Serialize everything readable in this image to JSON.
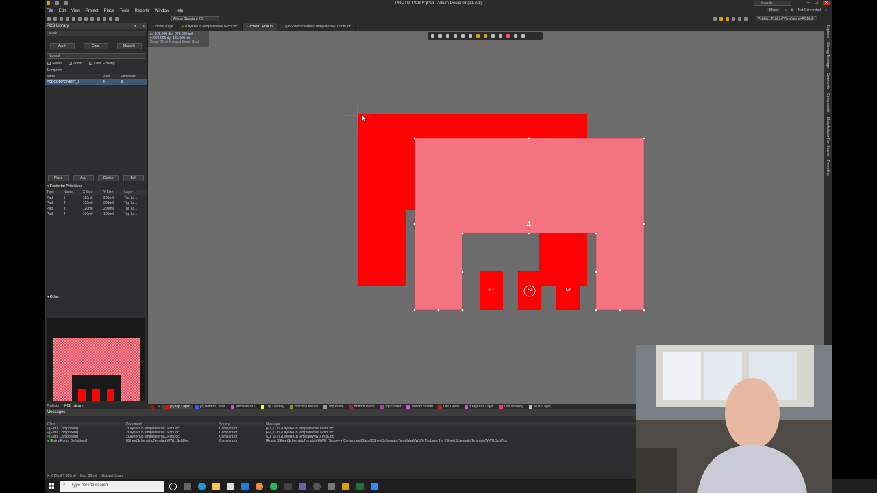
{
  "window": {
    "title": "PROTO_PCB.PrjPcb - Altium Designer (21.8.1)",
    "search_placeholder": "Search",
    "minimize": "–",
    "maximize": "☐",
    "close": "✕"
  },
  "menu": {
    "items": [
      "File",
      "Edit",
      "View",
      "Project",
      "Place",
      "Tools",
      "Reports",
      "Window",
      "Help"
    ],
    "share": "Share",
    "not_connected": "Not Connected"
  },
  "toolbar": {
    "view_combo": "Altium Standard 2D",
    "path": "PcbLib1.PcbLib?ViewName=PCBLib"
  },
  "doc_tabs": [
    {
      "label": "Home Page",
      "active": false
    },
    {
      "label": "2LayerPCBTemplateWWU.PcbDoc",
      "active": false
    },
    {
      "label": "PcbLib1.PcbLib",
      "active": true
    },
    {
      "label": "[1] 8SheetSchematicTemplateWWU.SchDoc",
      "active": false
    }
  ],
  "coords": {
    "line1": "x: -875.000   dx: -275.000 mil",
    "line2": "y:  925.000   dy:  125.000 mil",
    "line3": "Snap: 25mil Hotspot Snap: Real"
  },
  "left_panel": {
    "title": "PCB Library",
    "mask_label": "Mask",
    "apply": "Apply",
    "clear": "Clear",
    "magnify": "Magnify",
    "mode": "Normal",
    "checks": [
      "Select",
      "Zoom",
      "Clear Existing"
    ],
    "footprints_label": "Footprints",
    "fp_headers": [
      "Name",
      "Pads",
      "Primitives"
    ],
    "fp_rows": [
      [
        "PCBCOMPONENT_1",
        "4",
        "9"
      ]
    ],
    "btn_place": "Place",
    "btn_add": "Add",
    "btn_delete": "Delete",
    "btn_edit": "Edit",
    "primitives_title": "Footprint Primitives",
    "prim_headers": [
      "Type",
      "Name",
      "X-Size",
      "Y-Size",
      "Layer"
    ],
    "prim_rows": [
      [
        "Pad",
        "1",
        "120mil",
        "200mil",
        "Top La..."
      ],
      [
        "Pad",
        "2",
        "120mil",
        "200mil",
        "Top La..."
      ],
      [
        "Pad",
        "3",
        "120mil",
        "200mil",
        "Top La..."
      ],
      [
        "Pad",
        "4",
        "100mil",
        "100mil",
        "Top La..."
      ]
    ],
    "other_title": "Other"
  },
  "pads": {
    "pad4": "4",
    "pad1": "1",
    "pad2": "2",
    "pad3": "3"
  },
  "right_tabs": [
    "Explorer",
    "Storage Manager",
    "Comments",
    "Components",
    "Manufacturer Part Search",
    "Properties"
  ],
  "panel_tabs": [
    "Projects",
    "PCB Library"
  ],
  "layers": [
    {
      "label": "LS",
      "color": "#cc0000",
      "active": false
    },
    {
      "label": "[1] Top Layer",
      "color": "#ff0000",
      "active": true
    },
    {
      "label": "[2] Bottom Layer",
      "color": "#3355ff",
      "active": false
    },
    {
      "label": "Mechanical 1",
      "color": "#cc44cc",
      "active": false
    },
    {
      "label": "Top Overlay",
      "color": "#ffff00",
      "active": false
    },
    {
      "label": "Bottom Overlay",
      "color": "#888833",
      "active": false
    },
    {
      "label": "Top Paste",
      "color": "#999999",
      "active": false
    },
    {
      "label": "Bottom Paste",
      "color": "#883333",
      "active": false
    },
    {
      "label": "Top Solder",
      "color": "#aa4499",
      "active": false
    },
    {
      "label": "Bottom Solder",
      "color": "#cc55cc",
      "active": false
    },
    {
      "label": "Drill Guide",
      "color": "#aa2222",
      "active": false
    },
    {
      "label": "Keep-Out Layer",
      "color": "#ee44ee",
      "active": false
    },
    {
      "label": "Drill Drawing",
      "color": "#ff3366",
      "active": false
    },
    {
      "label": "Multi-Layer",
      "color": "#bbbbbb",
      "active": false
    }
  ],
  "messages": {
    "title": "Messages",
    "headers": [
      "Class",
      "Document",
      "Source",
      "Message"
    ],
    "rows": [
      [
        "[Extra Component]",
        "2LayerPCBTemplateWWU.PcbDoc",
        "Comparator",
        "[P1_1] in 2LayerPCBTemplateWWU.PcbDoc"
      ],
      [
        "[Extra Component]",
        "2LayerPCBTemplateWWU.PcbDoc",
        "Comparator",
        "[P2_1] in 2LayerPCBTemplateWWU.PcbDoc"
      ],
      [
        "[Extra Component]",
        "2LayerPCBTemplateWWU.PcbDoc",
        "Comparator",
        "[U1_1] in 2LayerPCBTemplateWWU.PcbDoc"
      ],
      [
        "[Extra Room Definitions]",
        "8SheetSchematicTemplateWWU.SchDoc",
        "Comparator",
        "[Room 8SheetSchematicTemplateWWU (Scope=InComponentClass('8SheetSchematicTemplateWWU')) TopLayer] in 8SheetSchematicTemplateWWU.SchDoc"
      ]
    ]
  },
  "status": {
    "coords": "X:-875mil Y:925mil",
    "grid": "Grid: 25mil",
    "snap": "(Hotspot Snap)"
  },
  "taskbar": {
    "search_placeholder": "Type here to search"
  }
}
